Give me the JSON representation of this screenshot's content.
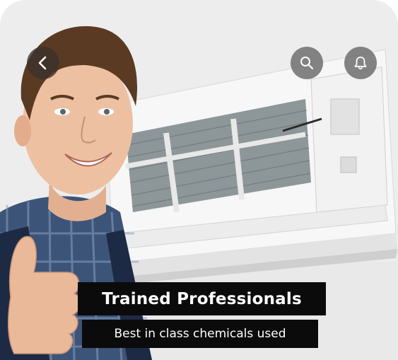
{
  "hero": {
    "title": "Trained Professionals",
    "subtitle": "Best in class chemicals used"
  },
  "nav": {
    "back_icon": "chevron-left-icon",
    "search_icon": "search-icon",
    "notification_icon": "bell-icon"
  },
  "colors": {
    "caption_bg": "#0b0b0b",
    "caption_text": "#ffffff",
    "icon_button_bg": "#6e6e6e"
  }
}
